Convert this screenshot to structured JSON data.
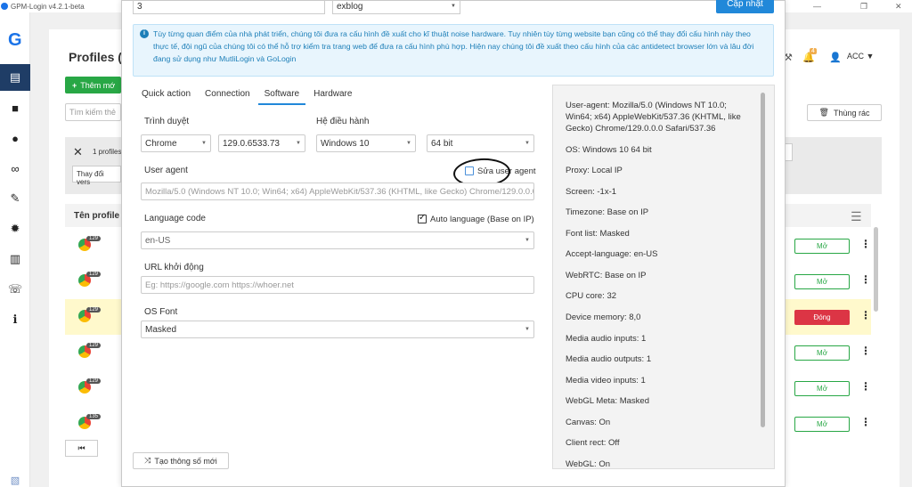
{
  "window": {
    "title": "GPM-Login v4.2.1-beta",
    "minimize": "—",
    "maximize": "❐",
    "close": "✕"
  },
  "rail": {
    "logo": "G"
  },
  "bg": {
    "title": "Profiles (",
    "add_label": "Thêm mớ",
    "search_placeholder": "Tìm kiếm thẻ",
    "trash_label": "Thùng rác",
    "account_label": "ACC",
    "bell_count": "4",
    "selected_count": "1 profiles",
    "change_label": "Thay đổi vers",
    "col_name": "Tên profile",
    "rows": [
      {
        "version": "129",
        "action": "Mở",
        "state": "open"
      },
      {
        "version": "129",
        "action": "Mở",
        "state": "open"
      },
      {
        "version": "129",
        "action": "Đóng",
        "state": "close"
      },
      {
        "version": "129",
        "action": "Mở",
        "state": "open"
      },
      {
        "version": "129",
        "action": "Mở",
        "state": "open"
      },
      {
        "version": "135",
        "action": "Mở",
        "state": "open"
      }
    ],
    "first_page": "⏮"
  },
  "modal": {
    "name_value": "3",
    "group_value": "exblog",
    "update_label": "Cập nhật",
    "info_text": "Tùy từng quan điểm của nhà phát triển, chúng tôi đưa ra cấu hình đề xuất cho kĩ thuật noise hardware. Tuy nhiên tùy từng website bạn cũng có thể thay đổi cấu hình này theo thực tế, đội ngũ của chúng tôi có thể hỗ trợ kiểm tra trang web để đưa ra cấu hình phù hợp. Hiện nay chúng tôi đề xuất theo cấu hình của các antidetect browser lớn và lâu đời đang sử dụng như MutliLogin và GoLogin",
    "tabs": [
      {
        "label": "Quick action",
        "active": false
      },
      {
        "label": "Connection",
        "active": false
      },
      {
        "label": "Software",
        "active": true
      },
      {
        "label": "Hardware",
        "active": false
      }
    ],
    "browser_label": "Trình duyệt",
    "browser_value": "Chrome",
    "browser_version": "129.0.6533.73",
    "os_label": "Hệ điều hành",
    "os_value": "Windows 10",
    "arch_value": "64 bit",
    "ua_label": "User agent",
    "edit_ua_label": "Sửa user agent",
    "ua_value": "Mozilla/5.0 (Windows NT 10.0; Win64; x64) AppleWebKit/537.36 (KHTML, like Gecko) Chrome/129.0.0.0 Safari/537.36",
    "lang_label": "Language code",
    "auto_lang_label": "Auto language (Base on IP)",
    "lang_value": "en-US",
    "url_label": "URL khởi động",
    "url_placeholder": "Eg: https://google.com https://whoer.net",
    "font_label": "OS Font",
    "font_value": "Masked",
    "new_params_label": "Tạo thông số mới",
    "summary": [
      "User-agent: Mozilla/5.0 (Windows NT 10.0; Win64; x64) AppleWebKit/537.36 (KHTML, like Gecko) Chrome/129.0.0.0 Safari/537.36",
      "OS: Windows 10 64 bit",
      "Proxy: Local IP",
      "Screen: -1x-1",
      "Timezone: Base on IP",
      "Font list: Masked",
      "Accept-language: en-US",
      "WebRTC: Base on IP",
      "CPU core: 32",
      "Device memory: 8,0",
      "Media audio inputs: 1",
      "Media audio outputs: 1",
      "Media video inputs: 1",
      "WebGL Meta: Masked",
      "Canvas: On",
      "Client rect: Off",
      "WebGL: On"
    ]
  },
  "colors": {
    "primary": "#2188d9",
    "success": "#28a745",
    "danger": "#dc3545",
    "rail_active": "#1f3d66",
    "info_bg": "#e8f5fd"
  }
}
